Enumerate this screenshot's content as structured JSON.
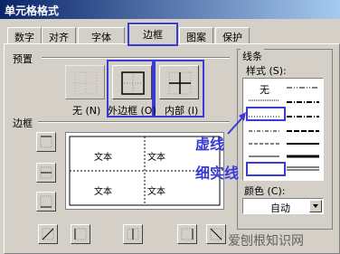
{
  "window": {
    "title": "单元格格式"
  },
  "tabs": [
    {
      "label": "数字"
    },
    {
      "label": "对齐"
    },
    {
      "label": "字体"
    },
    {
      "label": "边框"
    },
    {
      "label": "图案"
    },
    {
      "label": "保护"
    }
  ],
  "active_tab": "边框",
  "presets": {
    "heading": "预置",
    "items": [
      {
        "label": "无 (N)",
        "icon": "border-none-icon"
      },
      {
        "label": "外边框 (O)",
        "icon": "border-outline-icon"
      },
      {
        "label": "内部 (I)",
        "icon": "border-inside-icon"
      }
    ]
  },
  "border": {
    "heading": "边框",
    "preview_cells": [
      "文本",
      "文本",
      "文本",
      "文本"
    ]
  },
  "line": {
    "heading": "线条",
    "style_label": "样式 (S):",
    "none_option": "无",
    "color_label": "颜色 (C):",
    "color_value": "自动"
  },
  "annotations": {
    "dashed": "虚线",
    "thin_solid": "细实线"
  },
  "watermark": "爱刨根知识网",
  "accent_color": "#3a3ad8"
}
